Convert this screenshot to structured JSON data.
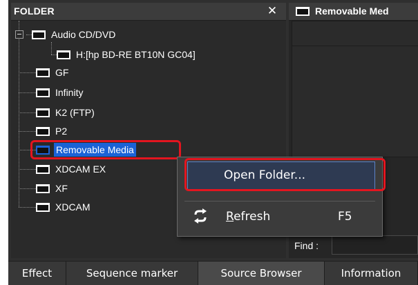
{
  "folder_panel": {
    "title": "FOLDER",
    "close_glyph": "✕",
    "tree": [
      {
        "label": "Audio CD/DVD",
        "icon": "folder-icon",
        "selected": false
      },
      {
        "label": "H:[hp BD-RE BT10N GC04]",
        "icon": "drive-icon",
        "selected": false
      },
      {
        "label": "GF",
        "icon": "folder-icon",
        "selected": false
      },
      {
        "label": "Infinity",
        "icon": "folder-icon",
        "selected": false
      },
      {
        "label": "K2 (FTP)",
        "icon": "folder-icon",
        "selected": false
      },
      {
        "label": "P2",
        "icon": "folder-icon",
        "selected": false
      },
      {
        "label": "Removable Media",
        "icon": "folder-icon",
        "selected": true
      },
      {
        "label": "XDCAM EX",
        "icon": "folder-icon",
        "selected": false
      },
      {
        "label": "XF",
        "icon": "folder-icon",
        "selected": false
      },
      {
        "label": "XDCAM",
        "icon": "folder-icon",
        "selected": false
      }
    ]
  },
  "right_panel": {
    "title": "Removable Med",
    "find_label": "Find :"
  },
  "context_menu": {
    "items": [
      {
        "label": "Open Folder...",
        "shortcut": "",
        "icon": ""
      },
      {
        "label_underlined_char": "R",
        "label_rest": "efresh",
        "shortcut": "F5",
        "icon": "refresh-icon"
      }
    ]
  },
  "tabs": [
    {
      "label": "Effect",
      "active": false
    },
    {
      "label": "Sequence marker",
      "active": false
    },
    {
      "label": "Source Browser",
      "active": true
    },
    {
      "label": "Information",
      "active": false
    }
  ],
  "colors": {
    "panel_bg": "#2a2a2a",
    "header_bg": "#3c3c3c",
    "selection_blue": "#1a62d6",
    "highlight_red": "#e3151f"
  }
}
